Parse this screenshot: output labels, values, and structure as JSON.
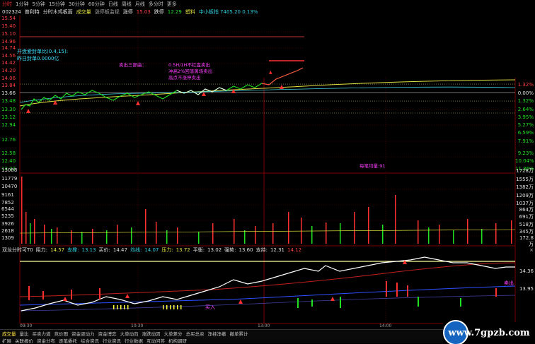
{
  "tabs": [
    "分时",
    "1分钟",
    "5分钟",
    "15分钟",
    "30分钟",
    "60分钟",
    "日线",
    "周线",
    "月线",
    "多分时",
    "更多"
  ],
  "info": {
    "code": "002324",
    "name": "普利特",
    "mode": "分时木鸡板面",
    "vol_label": "成交量",
    "series_label": "涨停板监视",
    "limit_up_label": "涨停",
    "limit_up_value": "15.03",
    "limit_down_label": "跌停",
    "limit_down_value": "12.29",
    "sector": "塑料",
    "index_text": "中小板指 7405.20 0.13%"
  },
  "price_axis_left": [
    "15.54",
    "15.40",
    "15.10",
    "14.96",
    "14.74",
    "14.56",
    "14.42",
    "14.20",
    "14.06",
    "13.84",
    "13.66",
    "13.48",
    "13.30",
    "13.12",
    "12.94",
    "12.76",
    "12.58",
    "12.40",
    "12.22"
  ],
  "price_axis_right": [
    "1.32%",
    "0.00%",
    "1.32%",
    "2.64%",
    "3.95%",
    "5.27%",
    "6.59%",
    "7.91%",
    "9.23%",
    "10.04%",
    "11.86%"
  ],
  "vol_axis_left": [
    "13088",
    "11779",
    "10470",
    "9161",
    "7852",
    "6544",
    "5235",
    "3926",
    "2618",
    "1309"
  ],
  "vol_axis_right": [
    "1728万",
    "1555万",
    "1382万",
    "1209万",
    "1037万",
    "864万",
    "691万",
    "518万",
    "345万",
    "172.8万"
  ],
  "popup": {
    "line1": "开盘爱封单比(0.4,15):",
    "line2": "昨日封单0.0000亿"
  },
  "annotations": {
    "group_a": "卖出三部曲：",
    "group_b1": "0.5H/1H不红盘卖出",
    "group_b2": "冲高2%回落离场卖出",
    "group_b3": "高点不涨停卖出",
    "avg_vol": "每笔均量:91"
  },
  "indicator": {
    "name": "双龙分时可T0",
    "r_label": "阻力:",
    "r_value": "14.57",
    "s_label": "支撑:",
    "s_value": "13.13",
    "buy_label": "买价:",
    "buy_value": "14.47",
    "avg_label": "均线:",
    "avg_value": "14.07",
    "pressure_label": "压力:",
    "pressure_value": "13.72",
    "balance_label": "平衡:",
    "balance_value": "13.02",
    "strong_label": "强势:",
    "strong_value": "13.60",
    "support2_label": "支持:",
    "support2_value": "12.31",
    "extra": "14.12",
    "close_symbol": "×",
    "right_top": "14.36",
    "right_bottom": "13.95",
    "tag_buy": "买入",
    "tag_sell": "卖出"
  },
  "time_axis": [
    "09:30",
    "10:30",
    "13:00",
    "14:00"
  ],
  "bottom_tabs_row1": [
    "成交量",
    "量比",
    "买卖力道",
    "竞价图",
    "资金驱动力",
    "资金博弈",
    "大单动向",
    "涨跌动因",
    "大单差分",
    "总买总卖",
    "净挂净撤",
    "撤单累计"
  ],
  "bottom_tabs_row2": [
    "扩展",
    "关联报价",
    "资金分布",
    "逐笔委托",
    "综合资讯",
    "行业资讯",
    "行业数据",
    "互动问答",
    "机构调研"
  ],
  "watermark": "www.7gpzb.com",
  "colors": {
    "up": "#ff3030",
    "down": "#20e020",
    "price_line": "#ffffff",
    "avg_line": "#ffff40",
    "grid": "#7a0000"
  }
}
